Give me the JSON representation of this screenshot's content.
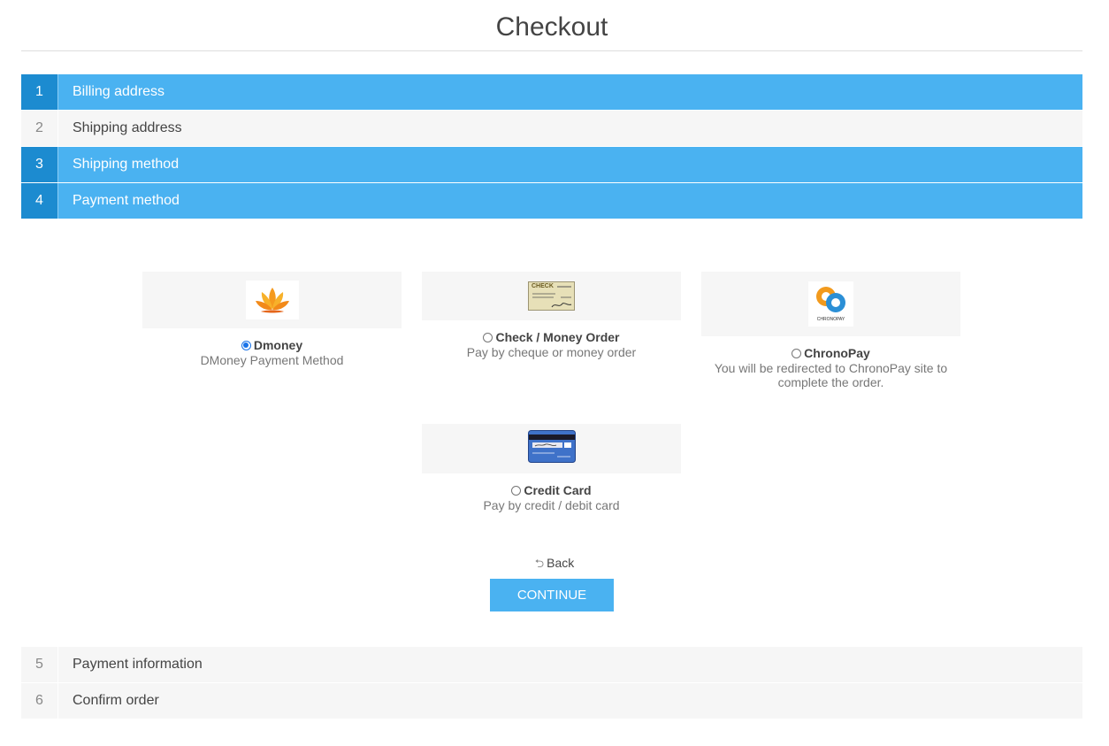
{
  "page": {
    "title": "Checkout"
  },
  "steps": [
    {
      "num": "1",
      "label": "Billing address"
    },
    {
      "num": "2",
      "label": "Shipping address"
    },
    {
      "num": "3",
      "label": "Shipping method"
    },
    {
      "num": "4",
      "label": "Payment method"
    },
    {
      "num": "5",
      "label": "Payment information"
    },
    {
      "num": "6",
      "label": "Confirm order"
    }
  ],
  "payment_methods": [
    {
      "name": "Dmoney",
      "description": "DMoney Payment Method",
      "selected": true,
      "icon": "lotus-logo-icon"
    },
    {
      "name": "Check / Money Order",
      "description": "Pay by cheque or money order",
      "selected": false,
      "icon": "check-icon",
      "icon_text": "CHECK"
    },
    {
      "name": "ChronoPay",
      "description": "You will be redirected to ChronoPay site to complete the order.",
      "selected": false,
      "icon": "chronopay-logo-icon",
      "icon_text": "CHRONOPAY"
    },
    {
      "name": "Credit Card",
      "description": "Pay by credit / debit card",
      "selected": false,
      "icon": "credit-card-icon"
    }
  ],
  "actions": {
    "back_label": "Back",
    "continue_label": "CONTINUE"
  },
  "colors": {
    "accent": "#4ab2f1",
    "accent_dark": "#1c8bd0",
    "inactive_bg": "#f6f6f6"
  }
}
